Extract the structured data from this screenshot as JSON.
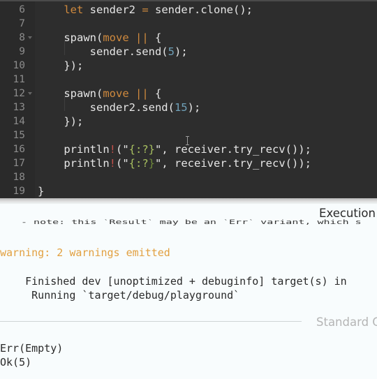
{
  "editor": {
    "lines": [
      {
        "n": "6",
        "fold": false,
        "tokens": [
          {
            "t": "    "
          },
          {
            "t": "let",
            "c": "kw"
          },
          {
            "t": " sender2 "
          },
          {
            "t": "=",
            "c": "kw"
          },
          {
            "t": " sender.clone();"
          }
        ]
      },
      {
        "n": "7",
        "fold": false,
        "tokens": []
      },
      {
        "n": "8",
        "fold": true,
        "tokens": [
          {
            "t": "    spawn("
          },
          {
            "t": "move",
            "c": "kw"
          },
          {
            "t": " "
          },
          {
            "t": "||",
            "c": "kw"
          },
          {
            "t": " {"
          }
        ]
      },
      {
        "n": "9",
        "fold": false,
        "tokens": [
          {
            "t": "        sender.send("
          },
          {
            "t": "5",
            "c": "num"
          },
          {
            "t": ");"
          }
        ]
      },
      {
        "n": "10",
        "fold": false,
        "tokens": [
          {
            "t": "    });"
          }
        ]
      },
      {
        "n": "11",
        "fold": false,
        "tokens": []
      },
      {
        "n": "12",
        "fold": true,
        "tokens": [
          {
            "t": "    spawn("
          },
          {
            "t": "move",
            "c": "kw"
          },
          {
            "t": " "
          },
          {
            "t": "||",
            "c": "kw"
          },
          {
            "t": " {"
          }
        ]
      },
      {
        "n": "13",
        "fold": false,
        "tokens": [
          {
            "t": "        sender2.send("
          },
          {
            "t": "15",
            "c": "num"
          },
          {
            "t": ");"
          }
        ]
      },
      {
        "n": "14",
        "fold": false,
        "tokens": [
          {
            "t": "    });"
          }
        ]
      },
      {
        "n": "15",
        "fold": false,
        "tokens": []
      },
      {
        "n": "16",
        "fold": false,
        "tokens": [
          {
            "t": "    println"
          },
          {
            "t": "!",
            "c": "mac"
          },
          {
            "t": "(\""
          },
          {
            "t": "{:?}",
            "c": "str"
          },
          {
            "t": "\", receiver.try_recv());"
          }
        ]
      },
      {
        "n": "17",
        "fold": false,
        "tokens": [
          {
            "t": "    println"
          },
          {
            "t": "!",
            "c": "mac"
          },
          {
            "t": "(\""
          },
          {
            "t": "{:?",
            "c": "str"
          },
          {
            "t": "}",
            "c": "brk"
          },
          {
            "t": "\", receiver.try_recv());"
          }
        ]
      },
      {
        "n": "18",
        "fold": false,
        "tokens": []
      },
      {
        "n": "19",
        "fold": false,
        "tokens": [
          {
            "t": "}"
          }
        ]
      }
    ]
  },
  "output": {
    "execution_header": "Execution",
    "note_line": "- note: this `Result` may be an `Err` variant, which s",
    "warning_line": "warning: 2 warnings emitted",
    "finished_line": "    Finished dev [unoptimized + debuginfo] target(s) in ",
    "running_line": "     Running `target/debug/playground`",
    "stdout_header": "Standard O",
    "stdout_lines": [
      "Err(Empty)",
      "Ok(5)"
    ]
  },
  "colors": {
    "editor_bg": "#2d2d2d",
    "keyword": "#d08a3e",
    "number": "#6fa0b8",
    "string": "#a8c060",
    "warning": "#e2a040"
  }
}
